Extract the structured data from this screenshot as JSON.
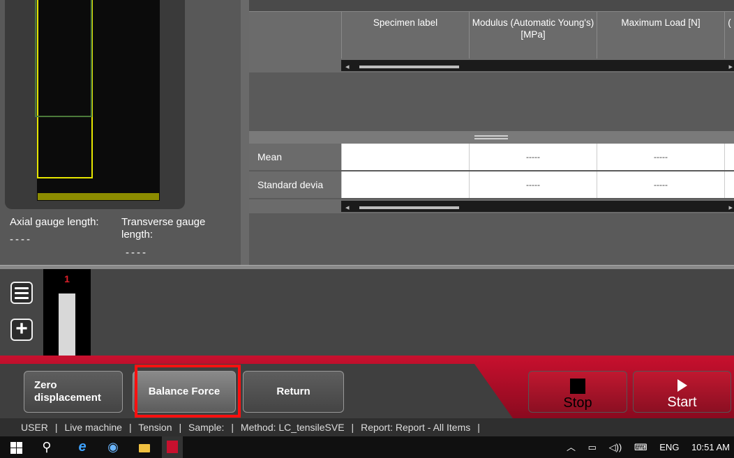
{
  "left_panel": {
    "axial_label": "Axial gauge length:",
    "axial_value": "----",
    "transverse_label": "Transverse gauge length:",
    "transverse_value": "----"
  },
  "table": {
    "headers": [
      "",
      "Specimen label",
      "Modulus (Automatic Young's) [MPa]",
      "Maximum Load [N]",
      "("
    ],
    "stats": [
      {
        "label": "Mean",
        "cells": [
          "",
          "-----",
          "-----",
          ""
        ]
      },
      {
        "label": "Standard devia",
        "cells": [
          "",
          "-----",
          "-----",
          ""
        ]
      }
    ]
  },
  "specimen_strip": {
    "specimen_number": "1"
  },
  "controls": {
    "zero_displacement": "Zero displacement",
    "balance_force": "Balance Force",
    "return": "Return",
    "stop": "Stop",
    "start": "Start"
  },
  "status_bar": {
    "user": "USER",
    "machine": "Live machine",
    "test_type": "Tension",
    "sample": "Sample:",
    "method": "Method: LC_tensileSVE",
    "report": "Report: Report - All Items"
  },
  "taskbar": {
    "language": "ENG",
    "time": "10:51 AM"
  },
  "colors": {
    "brand_red": "#c8102e",
    "highlight": "#ff1010",
    "specimen_outline": "#e6e600",
    "grip_outline": "#4b7a3a"
  }
}
